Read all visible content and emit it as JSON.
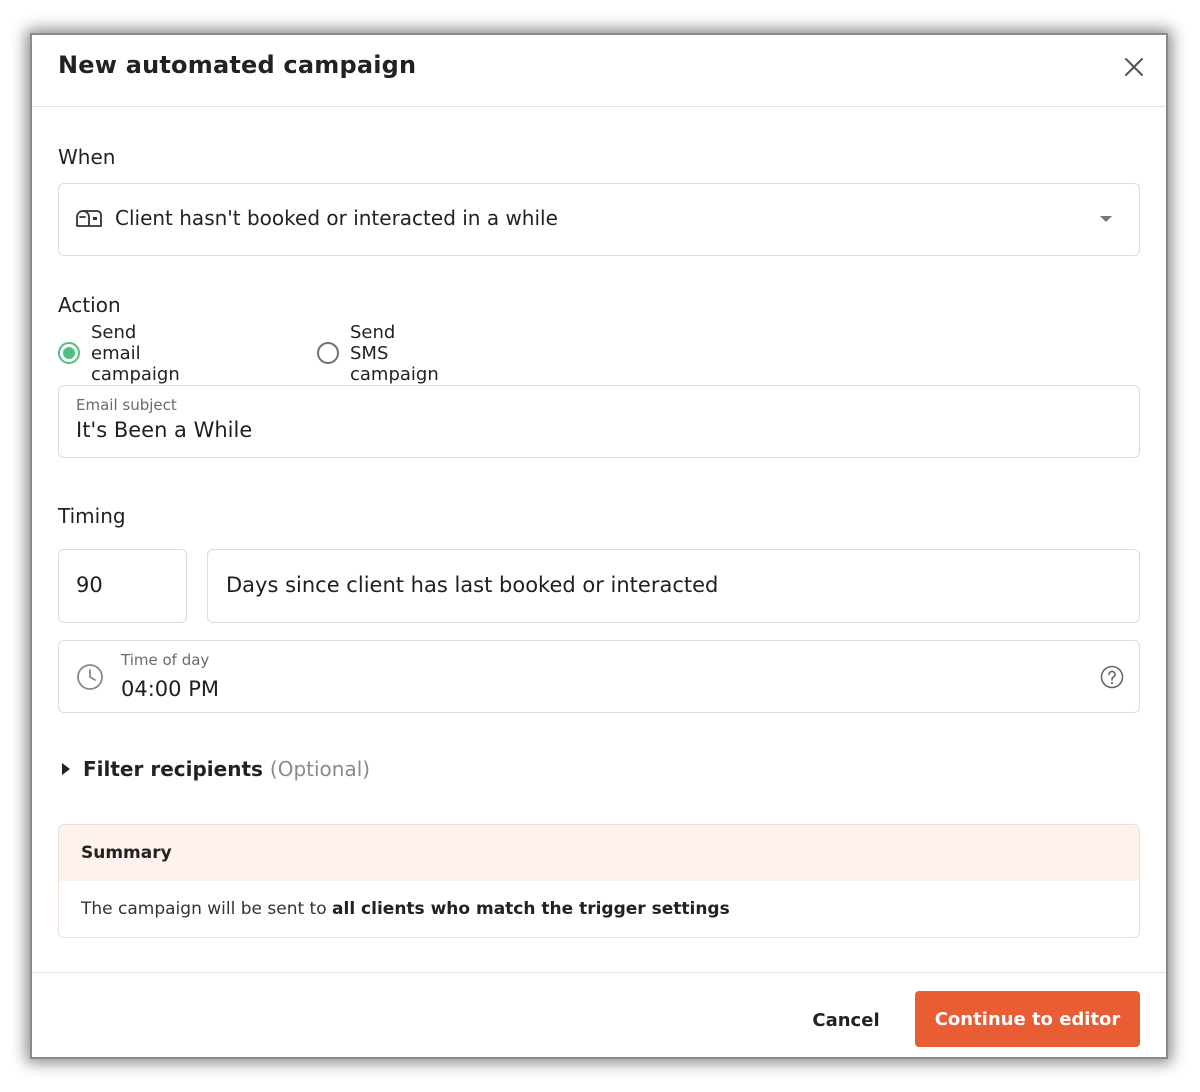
{
  "modal": {
    "title": "New automated campaign",
    "close_icon": "close-icon"
  },
  "when": {
    "label": "When",
    "trigger_icon": "mailbox-icon",
    "selected": "Client hasn't booked or interacted in a while"
  },
  "action": {
    "label": "Action",
    "options": [
      {
        "label": "Send email campaign",
        "checked": true
      },
      {
        "label": "Send SMS campaign",
        "checked": false
      }
    ],
    "email_subject_caption": "Email subject",
    "email_subject_value": "It's Been a While"
  },
  "timing": {
    "label": "Timing",
    "days_value": "90",
    "days_description": "Days since client has last booked or interacted",
    "time_caption": "Time of day",
    "time_value": "04:00 PM"
  },
  "filter": {
    "label": "Filter recipients",
    "optional": "(Optional)"
  },
  "summary": {
    "title": "Summary",
    "text_prefix": "The campaign will be sent to ",
    "text_bold": "all clients who match the trigger settings"
  },
  "footer": {
    "cancel_label": "Cancel",
    "continue_label": "Continue to editor"
  },
  "colors": {
    "accent": "#e85d33",
    "radio_checked": "#4fc07f",
    "summary_bg": "#fdf2ec"
  }
}
